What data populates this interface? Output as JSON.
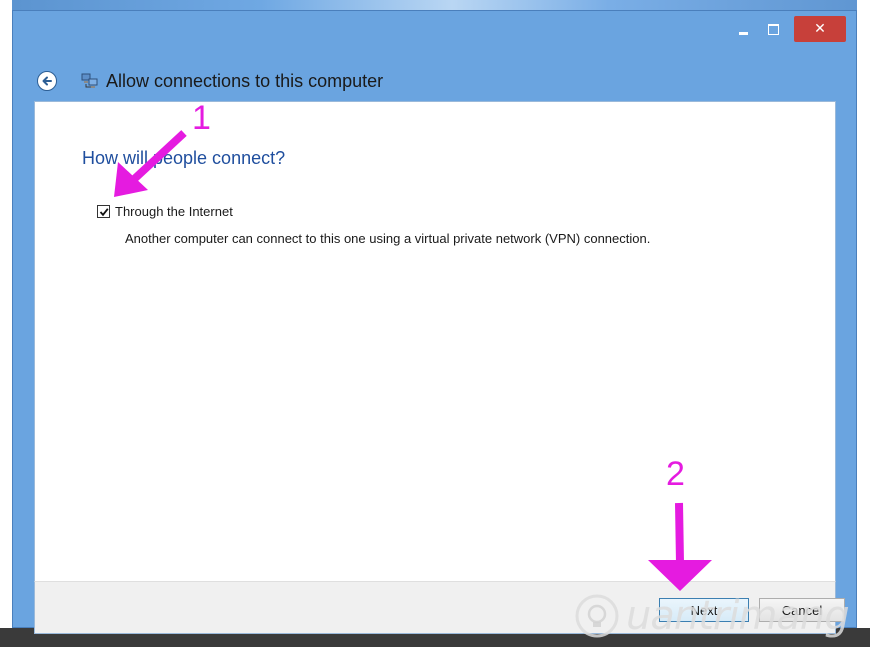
{
  "window": {
    "title": "Allow connections to this computer",
    "minimize_label": "",
    "maximize_label": "",
    "close_label": "✕"
  },
  "page": {
    "heading": "How will people connect?",
    "option": {
      "label": "Through the Internet",
      "checked": true,
      "description": "Another computer can connect to this one using a virtual private network (VPN) connection."
    }
  },
  "footer": {
    "next_label": "Next",
    "cancel_label": "Cancel"
  },
  "annotations": {
    "step1": "1",
    "step2": "2",
    "color": "#e51be0"
  },
  "watermark": {
    "text": "uantrimang"
  },
  "colors": {
    "titlebar": "#6aa4e0",
    "heading": "#1f4e9e",
    "close_button": "#c7403a"
  }
}
